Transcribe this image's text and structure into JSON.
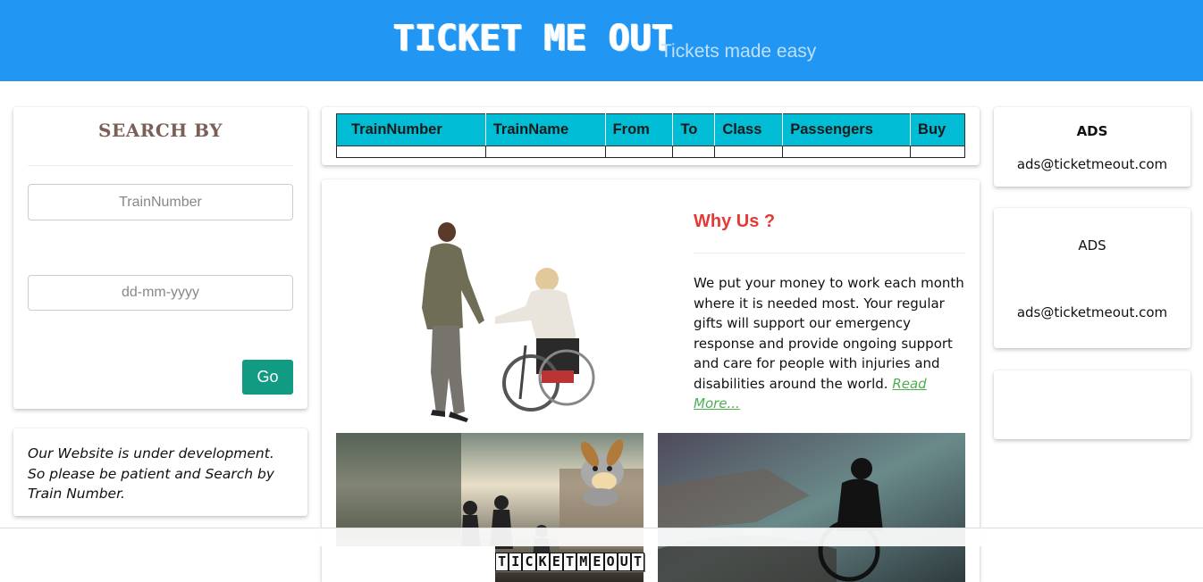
{
  "header": {
    "brand": "TICKET ME OUT",
    "tagline": "Tickets made easy"
  },
  "search": {
    "heading": "SEARCH BY",
    "train_number_placeholder": "TrainNumber",
    "date_placeholder": "dd-mm-yyyy",
    "go_label": "Go"
  },
  "notice": {
    "text": "Our Website is under development. So please be patient and Search by Train Number."
  },
  "trains_table": {
    "columns": [
      "TrainNumber",
      "TrainName",
      "From",
      "To",
      "Class",
      "Passengers",
      "Buy"
    ],
    "rows": []
  },
  "why_us": {
    "title": "Why Us ?",
    "body": "We put your money to work each month where it is needed most. Your regular gifts will support our emergency response and provide ongoing support and care for people with injuries and disabilities around the world.",
    "read_more": "Read More..."
  },
  "ads": [
    {
      "heading": "ADS",
      "email": "ads@ticketmeout.com"
    },
    {
      "heading": "ADS",
      "email": "ads@ticketmeout.com"
    }
  ],
  "footer": {
    "logo_letters": [
      "T",
      "I",
      "C",
      "K",
      "E",
      "T",
      "M",
      "E",
      "O",
      "U",
      "T"
    ]
  },
  "colors": {
    "header": "#2196f3",
    "table_header": "#00bcd4",
    "go_button": "#119b83",
    "why_title": "#e53935",
    "link": "#4caf50"
  }
}
